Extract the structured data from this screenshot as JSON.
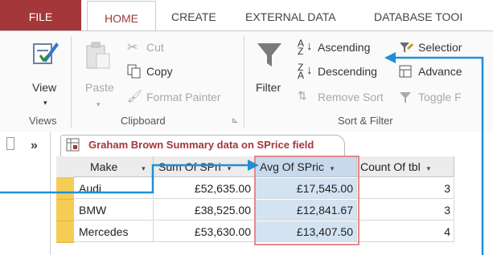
{
  "ribbon_tabs": [
    "FILE",
    "HOME",
    "CREATE",
    "EXTERNAL DATA",
    "DATABASE TOOI"
  ],
  "views": {
    "view_label": "View",
    "group_label": "Views"
  },
  "clipboard": {
    "paste_label": "Paste",
    "cut_label": "Cut",
    "copy_label": "Copy",
    "format_painter_label": "Format Painter",
    "group_label": "Clipboard"
  },
  "sort_filter": {
    "filter_label": "Filter",
    "ascending_label": "Ascending",
    "descending_label": "Descending",
    "remove_sort_label": "Remove Sort",
    "selection_label": "Selectior",
    "advanced_label": "Advance",
    "toggle_filter_label": "Toggle F",
    "group_label": "Sort & Filter"
  },
  "nav": {
    "collapse_label": "»"
  },
  "document": {
    "tab_title": "Graham Brown Summary data on SPrice field"
  },
  "datasheet": {
    "columns": [
      "Make",
      "Sum Of SPri",
      "Avg Of SPric",
      "Count Of tbl"
    ],
    "rows": [
      {
        "make": "Audi",
        "sum": "£52,635.00",
        "avg": "£17,545.00",
        "count": "3"
      },
      {
        "make": "BMW",
        "sum": "£38,525.00",
        "avg": "£12,841.67",
        "count": "3"
      },
      {
        "make": "Mercedes",
        "sum": "£53,630.00",
        "avg": "£13,407.50",
        "count": "4"
      }
    ]
  },
  "colors": {
    "file_tab": "#a4373a",
    "selected_column": "#d4e3f2",
    "row_selector": "#f5cd55",
    "annotation_arrow": "#1f8fd6",
    "highlight_box": "#e28a8a"
  }
}
